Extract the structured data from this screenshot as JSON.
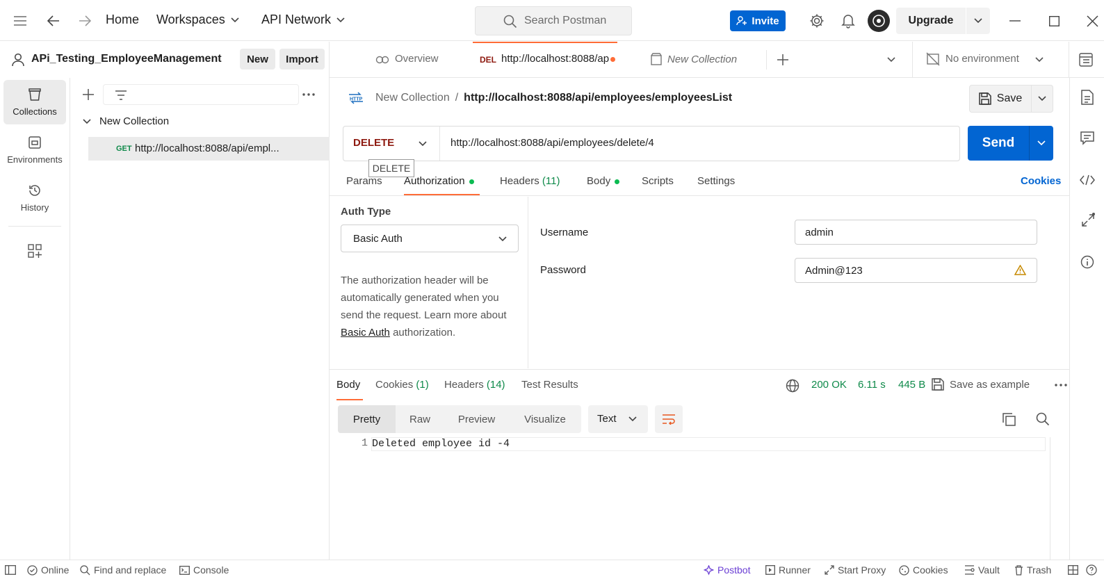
{
  "topbar": {
    "home": "Home",
    "workspaces": "Workspaces",
    "api_network": "API Network",
    "search_placeholder": "Search Postman",
    "invite": "Invite",
    "upgrade": "Upgrade"
  },
  "workspace": {
    "name": "APi_Testing_EmployeeManagement",
    "new_label": "New",
    "import_label": "Import"
  },
  "tabs": {
    "overview": "Overview",
    "active_method": "DEL",
    "active_title": "http://localhost:8088/ap",
    "collection_tab": "New Collection",
    "environment": "No environment"
  },
  "rail": {
    "items": [
      {
        "label": "Collections",
        "icon": "collections-icon"
      },
      {
        "label": "Environments",
        "icon": "environments-icon"
      },
      {
        "label": "History",
        "icon": "history-icon"
      }
    ]
  },
  "sidebar": {
    "collection_name": "New Collection",
    "request_method": "GET",
    "request_name": "http://localhost:8088/api/empl..."
  },
  "request": {
    "breadcrumb_parent": "New Collection",
    "breadcrumb_sep": "/",
    "breadcrumb_current": "http://localhost:8088/api/employees/employeesList",
    "save_label": "Save",
    "method": "DELETE",
    "url": "http://localhost:8088/api/employees/delete/4",
    "send_label": "Send",
    "tooltip": "DELETE",
    "tabs": {
      "params": "Params",
      "authorization": "Authorization",
      "headers": "Headers",
      "headers_count": "(11)",
      "body": "Body",
      "scripts": "Scripts",
      "settings": "Settings",
      "cookies": "Cookies"
    }
  },
  "auth": {
    "type_label": "Auth Type",
    "type_value": "Basic Auth",
    "desc_text": "The authorization header will be automatically generated when you send the request. Learn more about",
    "desc_link": "Basic Auth",
    "desc_tail": "authorization.",
    "username_label": "Username",
    "username_value": "admin",
    "password_label": "Password",
    "password_value": "Admin@123"
  },
  "response": {
    "tabs": {
      "body": "Body",
      "cookies": "Cookies",
      "cookies_count": "(1)",
      "headers": "Headers",
      "headers_count": "(14)",
      "test_results": "Test Results"
    },
    "status": "200 OK",
    "time": "6.11 s",
    "size": "445 B",
    "save_example": "Save as example",
    "views": [
      "Pretty",
      "Raw",
      "Preview",
      "Visualize"
    ],
    "format": "Text",
    "line_number": "1",
    "body_text": "Deleted employee id -4"
  },
  "statusbar": {
    "online": "Online",
    "find_replace": "Find and replace",
    "console": "Console",
    "postbot": "Postbot",
    "runner": "Runner",
    "start_proxy": "Start Proxy",
    "cookies": "Cookies",
    "vault": "Vault",
    "trash": "Trash"
  },
  "colors": {
    "accent": "#0265d2",
    "delete_method": "#8e1a10",
    "get_method": "#0f8a4a",
    "status_ok": "#0f8a4a",
    "tab_underline": "#ff6c37"
  }
}
